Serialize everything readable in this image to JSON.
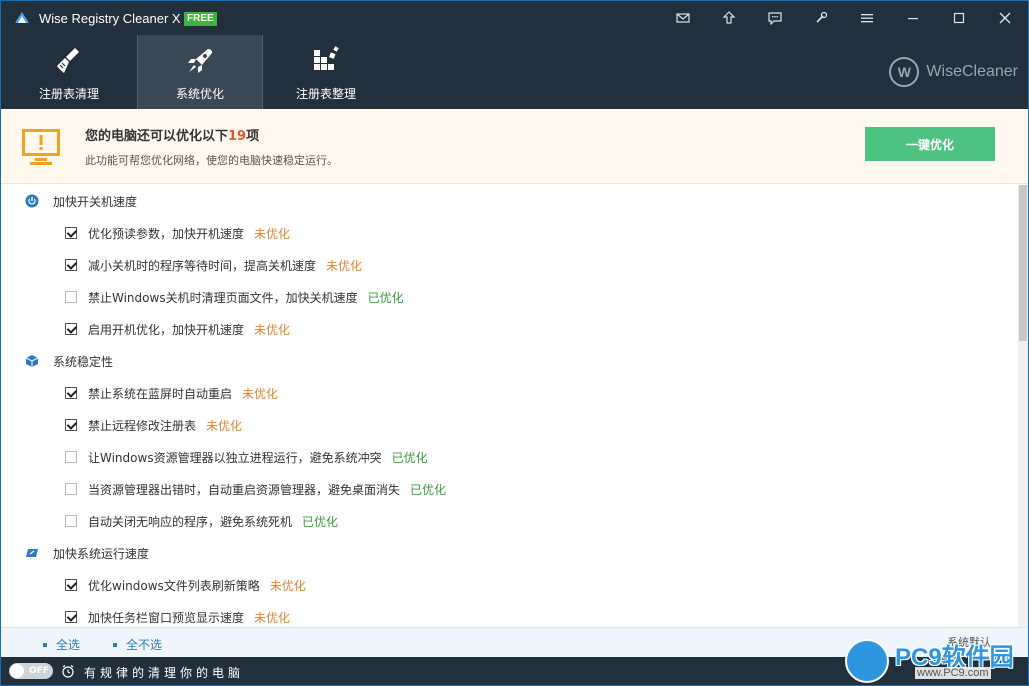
{
  "app": {
    "title": "Wise Registry Cleaner X",
    "badge": "FREE",
    "brand": "WiseCleaner",
    "brand_mark": "W"
  },
  "titlebar_icons": [
    "mail-icon",
    "upload-icon",
    "feedback-icon",
    "skin-icon",
    "menu-icon",
    "minimize-icon",
    "maximize-icon",
    "close-icon"
  ],
  "tabs": [
    {
      "label": "注册表清理",
      "icon": "broom-icon",
      "active": false
    },
    {
      "label": "系统优化",
      "icon": "rocket-icon",
      "active": true
    },
    {
      "label": "注册表整理",
      "icon": "blocks-icon",
      "active": false
    }
  ],
  "banner": {
    "title_prefix": "您的电脑还可以优化以下",
    "count": "19",
    "title_suffix": "项",
    "subtitle": "此功能可帮您优化网络，使您的电脑快速稳定运行。",
    "button": "一键优化"
  },
  "sections": [
    {
      "title": "加快开关机速度",
      "icon": "power-icon",
      "items": [
        {
          "label": "优化预读参数，加快开机速度",
          "checked": true,
          "status": "未优化"
        },
        {
          "label": "减小关机时的程序等待时间，提高关机速度",
          "checked": true,
          "status": "未优化"
        },
        {
          "label": "禁止Windows关机时清理页面文件，加快关机速度",
          "checked": false,
          "status": "已优化"
        },
        {
          "label": "启用开机优化，加快开机速度",
          "checked": true,
          "status": "未优化"
        }
      ]
    },
    {
      "title": "系统稳定性",
      "icon": "cube-icon",
      "items": [
        {
          "label": "禁止系统在蓝屏时自动重启",
          "checked": true,
          "status": "未优化"
        },
        {
          "label": "禁止远程修改注册表",
          "checked": true,
          "status": "未优化"
        },
        {
          "label": "让Windows资源管理器以独立进程运行，避免系统冲突",
          "checked": false,
          "status": "已优化"
        },
        {
          "label": "当资源管理器出错时，自动重启资源管理器，避免桌面消失",
          "checked": false,
          "status": "已优化"
        },
        {
          "label": "自动关闭无响应的程序，避免系统死机",
          "checked": false,
          "status": "已优化"
        }
      ]
    },
    {
      "title": "加快系统运行速度",
      "icon": "speed-icon",
      "items": [
        {
          "label": "优化windows文件列表刷新策略",
          "checked": true,
          "status": "未优化"
        },
        {
          "label": "加快任务栏窗口预览显示速度",
          "checked": true,
          "status": "未优化"
        }
      ]
    }
  ],
  "footer": {
    "select_all": "全选",
    "select_none": "全不选",
    "restore_default": "系统默认"
  },
  "statusbar": {
    "toggle": "OFF",
    "text": "有规律的清理你的电脑"
  },
  "watermark": {
    "text": "PC9软件园",
    "url": "www.PC9.com"
  },
  "colors": {
    "header": "#22303d",
    "accent_green": "#4ec283",
    "pending": "#e0842a",
    "done": "#3a9a3a",
    "count": "#e9572b"
  }
}
